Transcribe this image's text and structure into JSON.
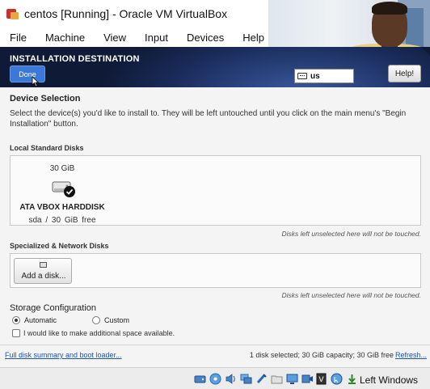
{
  "window": {
    "title": "centos [Running] - Oracle VM VirtualBox"
  },
  "menu": {
    "items": [
      "File",
      "Machine",
      "View",
      "Input",
      "Devices",
      "Help"
    ]
  },
  "installer": {
    "page_title": "INSTALLATION DESTINATION",
    "done_label": "Done",
    "keyboard_layout": "us",
    "help_label": "Help!"
  },
  "device_selection": {
    "title": "Device Selection",
    "description": "Select the device(s) you'd like to install to.  They will be left untouched until you click on the main menu's \"Begin Installation\" button."
  },
  "local_disks": {
    "title": "Local Standard Disks",
    "disk": {
      "size": "30 GiB",
      "name": "ATA VBOX HARDDISK",
      "info": "sda  /  30 GiB free",
      "selected": true
    },
    "note": "Disks left unselected here will not be touched."
  },
  "special_disks": {
    "title": "Specialized & Network Disks",
    "add_button": "Add a disk...",
    "note": "Disks left unselected here will not be touched."
  },
  "storage": {
    "title": "Storage Configuration",
    "automatic_label": "Automatic",
    "custom_label": "Custom",
    "selected": "Automatic",
    "reclaim_label": "I would like to make additional space available.",
    "reclaim_checked": false
  },
  "footer": {
    "summary_link": "Full disk summary and boot loader...",
    "status": "1 disk selected; 30 GiB capacity; 30 GiB free",
    "refresh_link": "Refresh..."
  },
  "vbox_statusbar": {
    "icons": [
      "hard-disk-icon",
      "optical-drive-icon",
      "audio-icon",
      "network-icon",
      "usb-icon",
      "shared-folders-icon",
      "display-icon",
      "video-capture-icon",
      "cpu-icon",
      "mouse-integration-icon",
      "host-key-icon"
    ],
    "host_key": "Left Windows"
  },
  "colors": {
    "header_bg": "#0f1a36",
    "done_button": "#3b78d8",
    "link": "#1a55b8"
  }
}
